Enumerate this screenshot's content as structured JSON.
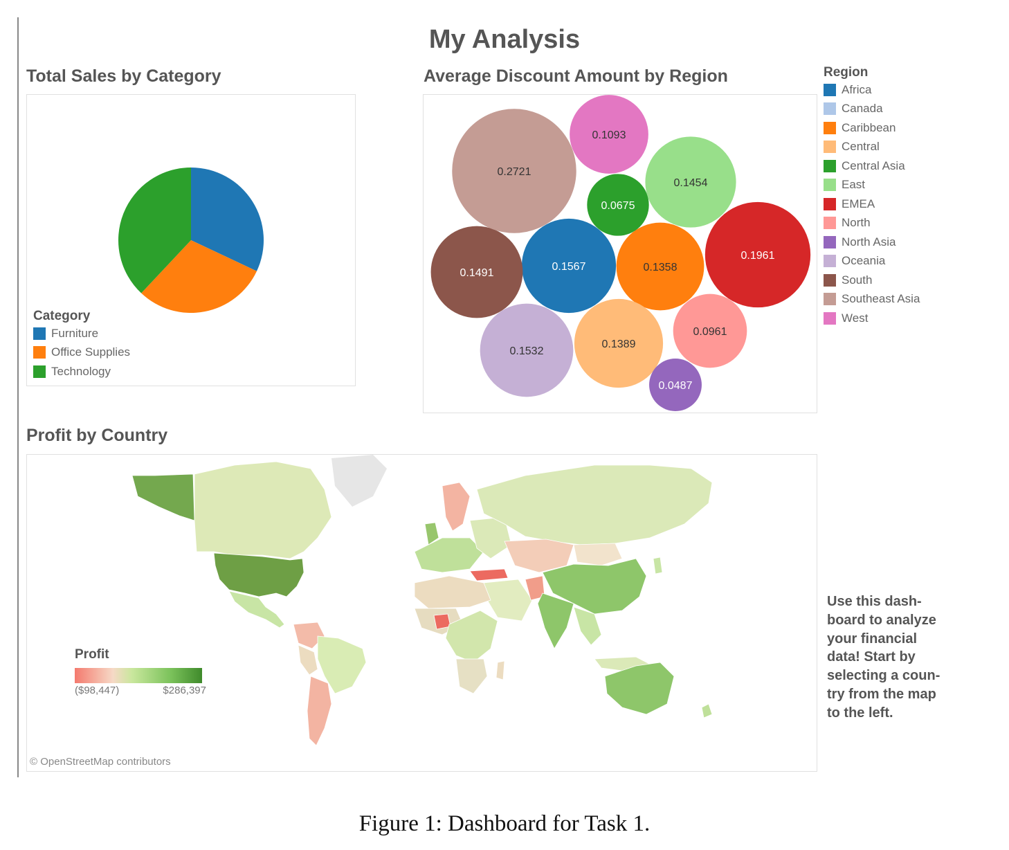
{
  "dashboard": {
    "title": "My Analysis",
    "note": "Use this dash-\nboard to analyze\nyour financial\ndata!  Start by\nselecting a coun-\ntry from the map\nto the left.",
    "caption": "Figure 1: Dashboard for Task 1."
  },
  "chart_data": [
    {
      "type": "pie",
      "title": "Total Sales by Category",
      "legend_title": "Category",
      "legend_position": "bottom-left",
      "slices": [
        {
          "label": "Furniture",
          "value": 32,
          "color": "#1f77b4"
        },
        {
          "label": "Office Supplies",
          "value": 30,
          "color": "#ff7f0e"
        },
        {
          "label": "Technology",
          "value": 38,
          "color": "#2ca02c"
        }
      ]
    },
    {
      "type": "bubble",
      "title": "Average Discount Amount by Region",
      "legend_title": "Region",
      "legend_position": "right",
      "bubbles": [
        {
          "region": "Africa",
          "value": 0.1567,
          "label": "0.1567",
          "color": "#1f77b4",
          "text_color": "#ffffff"
        },
        {
          "region": "Canada",
          "value": null,
          "label": "",
          "color": "#aec7e8",
          "text_color": "#333333"
        },
        {
          "region": "Caribbean",
          "value": 0.1358,
          "label": "0.1358",
          "color": "#ff7f0e",
          "text_color": "#333333"
        },
        {
          "region": "Central",
          "value": 0.1389,
          "label": "0.1389",
          "color": "#ffbb78",
          "text_color": "#333333"
        },
        {
          "region": "Central Asia",
          "value": 0.0675,
          "label": "0.0675",
          "color": "#2ca02c",
          "text_color": "#ffffff"
        },
        {
          "region": "East",
          "value": 0.1454,
          "label": "0.1454",
          "color": "#98df8a",
          "text_color": "#333333"
        },
        {
          "region": "EMEA",
          "value": 0.1961,
          "label": "0.1961",
          "color": "#d62728",
          "text_color": "#ffffff"
        },
        {
          "region": "North",
          "value": 0.0961,
          "label": "0.0961",
          "color": "#ff9896",
          "text_color": "#333333"
        },
        {
          "region": "North Asia",
          "value": 0.0487,
          "label": "0.0487",
          "color": "#9467bd",
          "text_color": "#ffffff"
        },
        {
          "region": "Oceania",
          "value": 0.1532,
          "label": "0.1532",
          "color": "#c5b0d5",
          "text_color": "#333333"
        },
        {
          "region": "South",
          "value": 0.1491,
          "label": "0.1491",
          "color": "#8c564b",
          "text_color": "#ffffff"
        },
        {
          "region": "Southeast Asia",
          "value": 0.2721,
          "label": "0.2721",
          "color": "#c49c94",
          "text_color": "#333333"
        },
        {
          "region": "West",
          "value": 0.1093,
          "label": "0.1093",
          "color": "#e377c2",
          "text_color": "#333333"
        }
      ]
    },
    {
      "type": "map",
      "title": "Profit by Country",
      "legend_title": "Profit",
      "legend_min": "($98,447)",
      "legend_max": "$286,397",
      "attribution": "© OpenStreetMap contributors",
      "colors": {
        "low": "#f47a6e",
        "mid": "#f6e6cc",
        "high": "#3f8a2b"
      }
    }
  ]
}
